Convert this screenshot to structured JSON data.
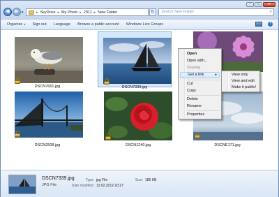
{
  "window": {
    "caption_buttons": {
      "minimize": "–",
      "maximize": "▭",
      "close": "✕"
    }
  },
  "nav": {
    "back": "◀",
    "forward": "▶",
    "dropdown": "▾"
  },
  "address_bar": {
    "separator": "▸",
    "crumbs": [
      "SkyDrive",
      "My Photo",
      "2011",
      "New Folder"
    ]
  },
  "search": {
    "placeholder": "Search New Folder"
  },
  "toolbar": {
    "organize": "Organize",
    "sign_out": "Sign out",
    "language": "Language",
    "browse_public": "Browse a public account",
    "live_groups": "Windows Live Groups",
    "help": "?"
  },
  "files": [
    {
      "name": "DSCN7661.jpg",
      "subject": "bird"
    },
    {
      "name": "DSCN7339.jpg",
      "subject": "sailboat",
      "selected": true
    },
    {
      "name": "",
      "subject": "flowers"
    },
    {
      "name": "DSCN2508.jpg",
      "subject": "bridge"
    },
    {
      "name": "DSCN1240.jpg",
      "subject": "rose"
    },
    {
      "name": "DSCNE171.jpg",
      "subject": "sky"
    }
  ],
  "context_menu": {
    "items": [
      "Open",
      "Open with...",
      "Sharing",
      "Get a link",
      "Cut",
      "Copy",
      "Delete",
      "Rename",
      "Properties"
    ],
    "disabled": [
      "Sharing"
    ],
    "highlighted": "Get a link"
  },
  "submenu": {
    "items": [
      "View only",
      "View and edit",
      "Make it public!"
    ]
  },
  "details": {
    "name": "DSCN7339.jpg",
    "kind": "JPG File",
    "type_label": "Type:",
    "type_value": "jpg File",
    "modified_label": "Date modified:",
    "modified_value": "13.02.2012 20:27",
    "size_label": "Size:",
    "size_value": "186 KB"
  },
  "colors": {
    "accent": "#2d6fb8",
    "selection": "#d5e8fb",
    "menu_bg": "#f0f0f0"
  }
}
